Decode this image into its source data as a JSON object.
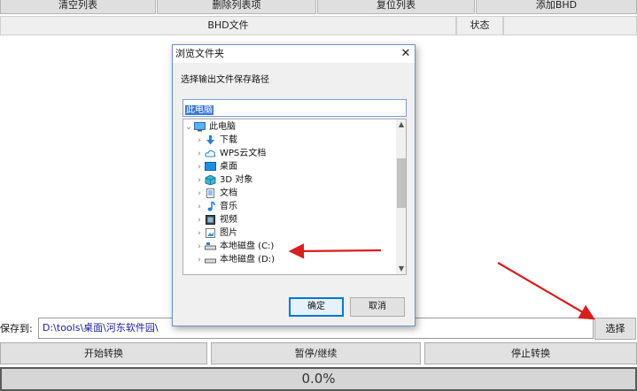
{
  "toolbar": {
    "clear": "清空列表",
    "delete": "删除列表项",
    "reset": "复位列表",
    "add": "添加BHD"
  },
  "table": {
    "col_file": "BHD文件",
    "col_status": "状态"
  },
  "bottom": {
    "save_label": "保存到:",
    "save_path": "D:\\tools\\桌面\\河东软件园\\",
    "select_button": "选择",
    "start_button": "开始转换",
    "pause_button": "暂停/继续",
    "stop_button": "停止转换",
    "progress_text": "0.0%",
    "progress_value": 0.0
  },
  "dialog": {
    "title": "浏览文件夹",
    "description": "选择输出文件保存路径",
    "edit_value": "此电脑",
    "ok": "确定",
    "cancel": "取消",
    "tree": [
      {
        "label": "此电脑",
        "icon": "computer-icon"
      },
      {
        "label": "下载",
        "icon": "download-arrow-icon"
      },
      {
        "label": "WPS云文档",
        "icon": "cloud-icon"
      },
      {
        "label": "桌面",
        "icon": "desktop-icon"
      },
      {
        "label": "3D 对象",
        "icon": "cube-icon"
      },
      {
        "label": "文档",
        "icon": "document-icon"
      },
      {
        "label": "音乐",
        "icon": "music-note-icon"
      },
      {
        "label": "视频",
        "icon": "video-icon"
      },
      {
        "label": "图片",
        "icon": "picture-icon"
      },
      {
        "label": "本地磁盘 (C:)",
        "icon": "drive-icon"
      },
      {
        "label": "本地磁盘 (D:)",
        "icon": "drive-icon"
      }
    ]
  },
  "colors": {
    "arrow": "#d81e1e",
    "accent": "#0078d7",
    "selection": "#3b78d6"
  }
}
